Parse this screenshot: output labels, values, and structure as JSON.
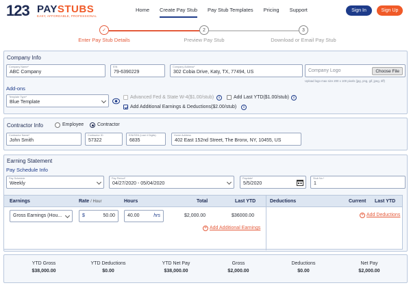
{
  "brand": {
    "logo_num": "123",
    "logo_pay": "PAY",
    "logo_stubs": "STUBS",
    "tagline": "EASY, AFFORDABLE, PROFESSIONAL",
    "accent": "#f05a28",
    "primary": "#1d3b8a"
  },
  "nav": {
    "items": [
      "Home",
      "Create Pay Stub",
      "Pay Stub Templates",
      "Pricing",
      "Support"
    ],
    "signin": "Sign In",
    "signup": "Sign Up"
  },
  "steps": [
    {
      "num": "✓",
      "label": "Enter Pay Stub Details",
      "state": "active"
    },
    {
      "num": "2",
      "label": "Preview Pay Stub",
      "state": "pending"
    },
    {
      "num": "3",
      "label": "Download or Email Pay Stub",
      "state": "pending"
    }
  ],
  "company": {
    "title": "Company Info",
    "name_label": "Company Name*",
    "name": "ABC Company",
    "ein_label": "EIN",
    "ein": "79-6390229",
    "address_label": "Company Address*",
    "address": "302 Cobia Drive, Katy, TX, 77494, US",
    "logo_placeholder": "Company Logo",
    "choose_file": "Choose File",
    "logo_hint": "Upload logo max size 200 x 100 pixels (jpg, png, gif, jpeg, tiff)"
  },
  "addons": {
    "title": "Add-ons",
    "template_label": "Template Type*",
    "template": "Blue Template",
    "opt1": "Advanced Fed & State W-4($1.00/stub)",
    "opt2": "Add Last YTD($1.00/stub)",
    "opt3": "Add Additional Earnings & Deductions($2.00/stub)"
  },
  "contractor": {
    "title": "Contractor Info",
    "type_employee": "Employee",
    "type_contractor": "Contractor",
    "name_label": "Contractor Name*",
    "name": "John Smith",
    "id_label": "Contractor ID",
    "id": "57322",
    "ssn_label": "EIN/SSN (Last 4 Digits)",
    "ssn": "6835",
    "address_label": "Home Address",
    "address": "402 East 152nd Street, The Bronx, NY, 10455, US"
  },
  "earning": {
    "title": "Earning Statement",
    "schedule_title": "Pay Schedule Info",
    "schedule_label": "Pay Schedule",
    "schedule": "Weekly",
    "period_label": "Pay Period*",
    "period": "04/27/2020 - 05/04/2020",
    "paydate_label": "Paydate*",
    "paydate": "5/5/2020",
    "stubno_label": "Stub No.*",
    "stubno": "1"
  },
  "table": {
    "h_earnings": "Earnings",
    "h_rate": "Rate",
    "h_rate_unit": "/ Hour",
    "h_hours": "Hours",
    "h_total": "Total",
    "h_lastytd": "Last YTD",
    "h_deductions": "Deductions",
    "h_current": "Current",
    "h_lastytd2": "Last YTD",
    "earning_type": "Gross Earnings (Hou...",
    "rate_sym": "$",
    "rate": "50.00",
    "hours": "40.00",
    "hours_unit": "hrs",
    "total": "$2,000.00",
    "lastytd": "$36000.00",
    "add_earnings": "Add Additional Earnings",
    "add_deductions": "Add Deductions"
  },
  "totals": [
    {
      "label": "YTD Gross",
      "value": "$38,000.00"
    },
    {
      "label": "YTD Deductions",
      "value": "$0.00"
    },
    {
      "label": "YTD Net Pay",
      "value": "$38,000.00"
    },
    {
      "label": "Gross",
      "value": "$2,000.00"
    },
    {
      "label": "Deductions",
      "value": "$0.00"
    },
    {
      "label": "Net Pay",
      "value": "$2,000.00"
    }
  ]
}
